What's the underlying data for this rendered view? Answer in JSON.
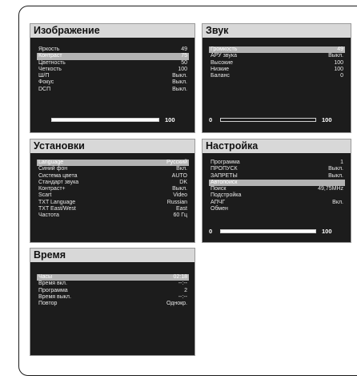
{
  "panels": {
    "picture": {
      "title": "Изображение",
      "rows": [
        {
          "label": "Яркость",
          "value": "49"
        },
        {
          "label": "Контраст",
          "value": "75"
        },
        {
          "label": "Цветность",
          "value": "50"
        },
        {
          "label": "Четкость",
          "value": "100"
        },
        {
          "label": "Ш/П",
          "value": "Выкл."
        },
        {
          "label": "Фокус",
          "value": "Выкл."
        },
        {
          "label": "DCП",
          "value": "Выкл."
        }
      ],
      "slider": {
        "value": "100",
        "fraction": 1.0
      }
    },
    "sound": {
      "title": "Звук",
      "rows": [
        {
          "label": "Громкость",
          "value": "49"
        },
        {
          "label": "АРУ звука",
          "value": "Выкл."
        },
        {
          "label": "Высокие",
          "value": "100"
        },
        {
          "label": "Низкие",
          "value": "100"
        },
        {
          "label": "Баланс",
          "value": "0"
        }
      ],
      "slider": {
        "left": "0",
        "value": "100",
        "fraction": 0.0
      }
    },
    "setup": {
      "title": "Установки",
      "rows": [
        {
          "label": "Language",
          "value": "Русский"
        },
        {
          "label": "Синий фон",
          "value": "Вкл."
        },
        {
          "label": "Система цвета",
          "value": "AUTO"
        },
        {
          "label": "Стандарт звука",
          "value": "DK"
        },
        {
          "label": "Контраст+",
          "value": "Выкл."
        },
        {
          "label": "Scart",
          "value": "Video"
        },
        {
          "label": "TXT Language",
          "value": "Russian"
        },
        {
          "label": "TXT East/West",
          "value": "East"
        },
        {
          "label": "Частота",
          "value": "60 Гц"
        }
      ]
    },
    "tuning": {
      "title": "Настройка",
      "rows": [
        {
          "label": "Программа",
          "value": "1"
        },
        {
          "label": "ПРОПУСК",
          "value": "Выкл."
        },
        {
          "label": "ЗАПРЕТЫ",
          "value": "Выкл."
        },
        {
          "label": "Автопоиск",
          "value": ""
        },
        {
          "label": "Поиск",
          "value": "49,75MHz"
        },
        {
          "label": "Подстройка",
          "value": ""
        },
        {
          "label": "АПЧГ",
          "value": "Вкл."
        },
        {
          "label": "Обмен",
          "value": ""
        }
      ],
      "slider": {
        "left": "0",
        "value": "100",
        "fraction": 1.0
      }
    },
    "time": {
      "title": "Время",
      "rows": [
        {
          "label": "Часы",
          "value": "02:18"
        },
        {
          "label": "Время вкл.",
          "value": "--:--"
        },
        {
          "label": "Программа",
          "value": "2"
        },
        {
          "label": "Время выкл.",
          "value": "--:--"
        },
        {
          "label": "Повтор",
          "value": "Однокр."
        }
      ]
    }
  },
  "selected": {
    "picture": 1,
    "sound": 0,
    "setup": 0,
    "tuning": 3,
    "time": 0
  }
}
